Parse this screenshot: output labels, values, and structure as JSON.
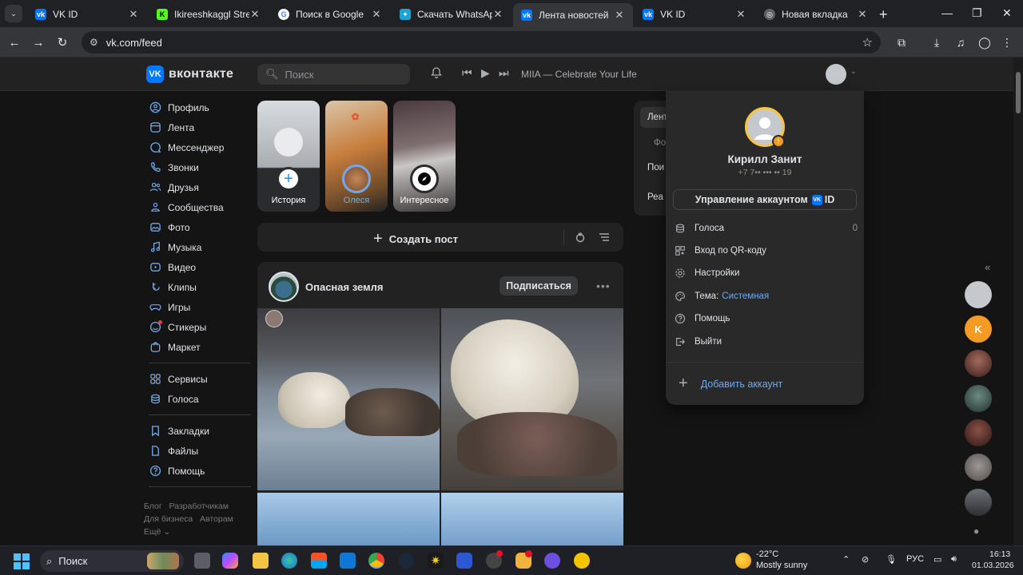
{
  "browser": {
    "tabs": [
      {
        "title": "VK ID",
        "favicon_color": "#0077ff",
        "favicon_text": "vk",
        "active": false
      },
      {
        "title": "Ikireeshkaggl Stream",
        "favicon_color": "#53fc18",
        "favicon_text": "K",
        "active": false
      },
      {
        "title": "Поиск в Google",
        "favicon_color": "#ffffff",
        "favicon_text": "G",
        "active": false
      },
      {
        "title": "Скачать WhatsApp M",
        "favicon_color": "#1ba3d8",
        "favicon_text": "✦",
        "active": false
      },
      {
        "title": "Лента новостей",
        "favicon_color": "#0077ff",
        "favicon_text": "vk",
        "active": true
      },
      {
        "title": "VK ID",
        "favicon_color": "#0077ff",
        "favicon_text": "vk",
        "active": false
      },
      {
        "title": "Новая вкладка",
        "favicon_color": "#5f6368",
        "favicon_text": "◎",
        "active": false
      }
    ],
    "url": "vk.com/feed"
  },
  "vk_header": {
    "logo_text": "вконтакте",
    "search_placeholder": "Поиск",
    "now_playing": "MIIA — Celebrate Your Life"
  },
  "left_menu": {
    "group1": [
      {
        "label": "Профиль",
        "icon": "user-circle-icon"
      },
      {
        "label": "Лента",
        "icon": "feed-icon"
      },
      {
        "label": "Мессенджер",
        "icon": "message-icon"
      },
      {
        "label": "Звонки",
        "icon": "phone-icon"
      },
      {
        "label": "Друзья",
        "icon": "friends-icon"
      },
      {
        "label": "Сообщества",
        "icon": "community-icon"
      },
      {
        "label": "Фото",
        "icon": "photo-icon"
      },
      {
        "label": "Музыка",
        "icon": "music-icon"
      },
      {
        "label": "Видео",
        "icon": "video-icon"
      },
      {
        "label": "Клипы",
        "icon": "clips-icon"
      },
      {
        "label": "Игры",
        "icon": "gamepad-icon"
      },
      {
        "label": "Стикеры",
        "icon": "smile-icon"
      },
      {
        "label": "Маркет",
        "icon": "market-icon"
      }
    ],
    "group2": [
      {
        "label": "Сервисы",
        "icon": "services-icon"
      },
      {
        "label": "Голоса",
        "icon": "coins-icon"
      }
    ],
    "group3": [
      {
        "label": "Закладки",
        "icon": "bookmark-icon"
      },
      {
        "label": "Файлы",
        "icon": "file-icon"
      },
      {
        "label": "Помощь",
        "icon": "help-icon"
      }
    ],
    "footer": {
      "blog": "Блог",
      "developers": "Разработчикам",
      "business": "Для бизнеса",
      "authors": "Авторам",
      "more": "Ещё ⌄"
    }
  },
  "stories": [
    {
      "label": "История"
    },
    {
      "label": "Олеся"
    },
    {
      "label": "Интересное"
    }
  ],
  "create_post": {
    "label": "Создать пост"
  },
  "post": {
    "author": "Опасная земля",
    "subscribe_label": "Подписаться"
  },
  "right_panel_peek": [
    "Лент",
    "Фо",
    "Пои",
    "Реа"
  ],
  "account_dropdown": {
    "name": "Кирилл Занит",
    "phone": "+7 7•• ••• •• 19",
    "manage_label": "Управление аккаунтом",
    "manage_suffix": "ID",
    "items": [
      {
        "label": "Голоса",
        "value": "0",
        "icon": "coins-icon"
      },
      {
        "label": "Вход по QR-коду",
        "icon": "qr-icon"
      },
      {
        "label": "Настройки",
        "icon": "gear-icon"
      },
      {
        "label": "Тема:",
        "accent": "Системная",
        "icon": "palette-icon"
      },
      {
        "label": "Помощь",
        "icon": "help-icon"
      },
      {
        "label": "Выйти",
        "icon": "logout-icon"
      }
    ],
    "add_account_label": "Добавить аккаунт"
  },
  "taskbar": {
    "search_label": "Поиск",
    "weather_temp": "-22°C",
    "weather_text": "Mostly sunny",
    "lang": "РУС",
    "time": "16:13",
    "date": "01.03.2026"
  }
}
